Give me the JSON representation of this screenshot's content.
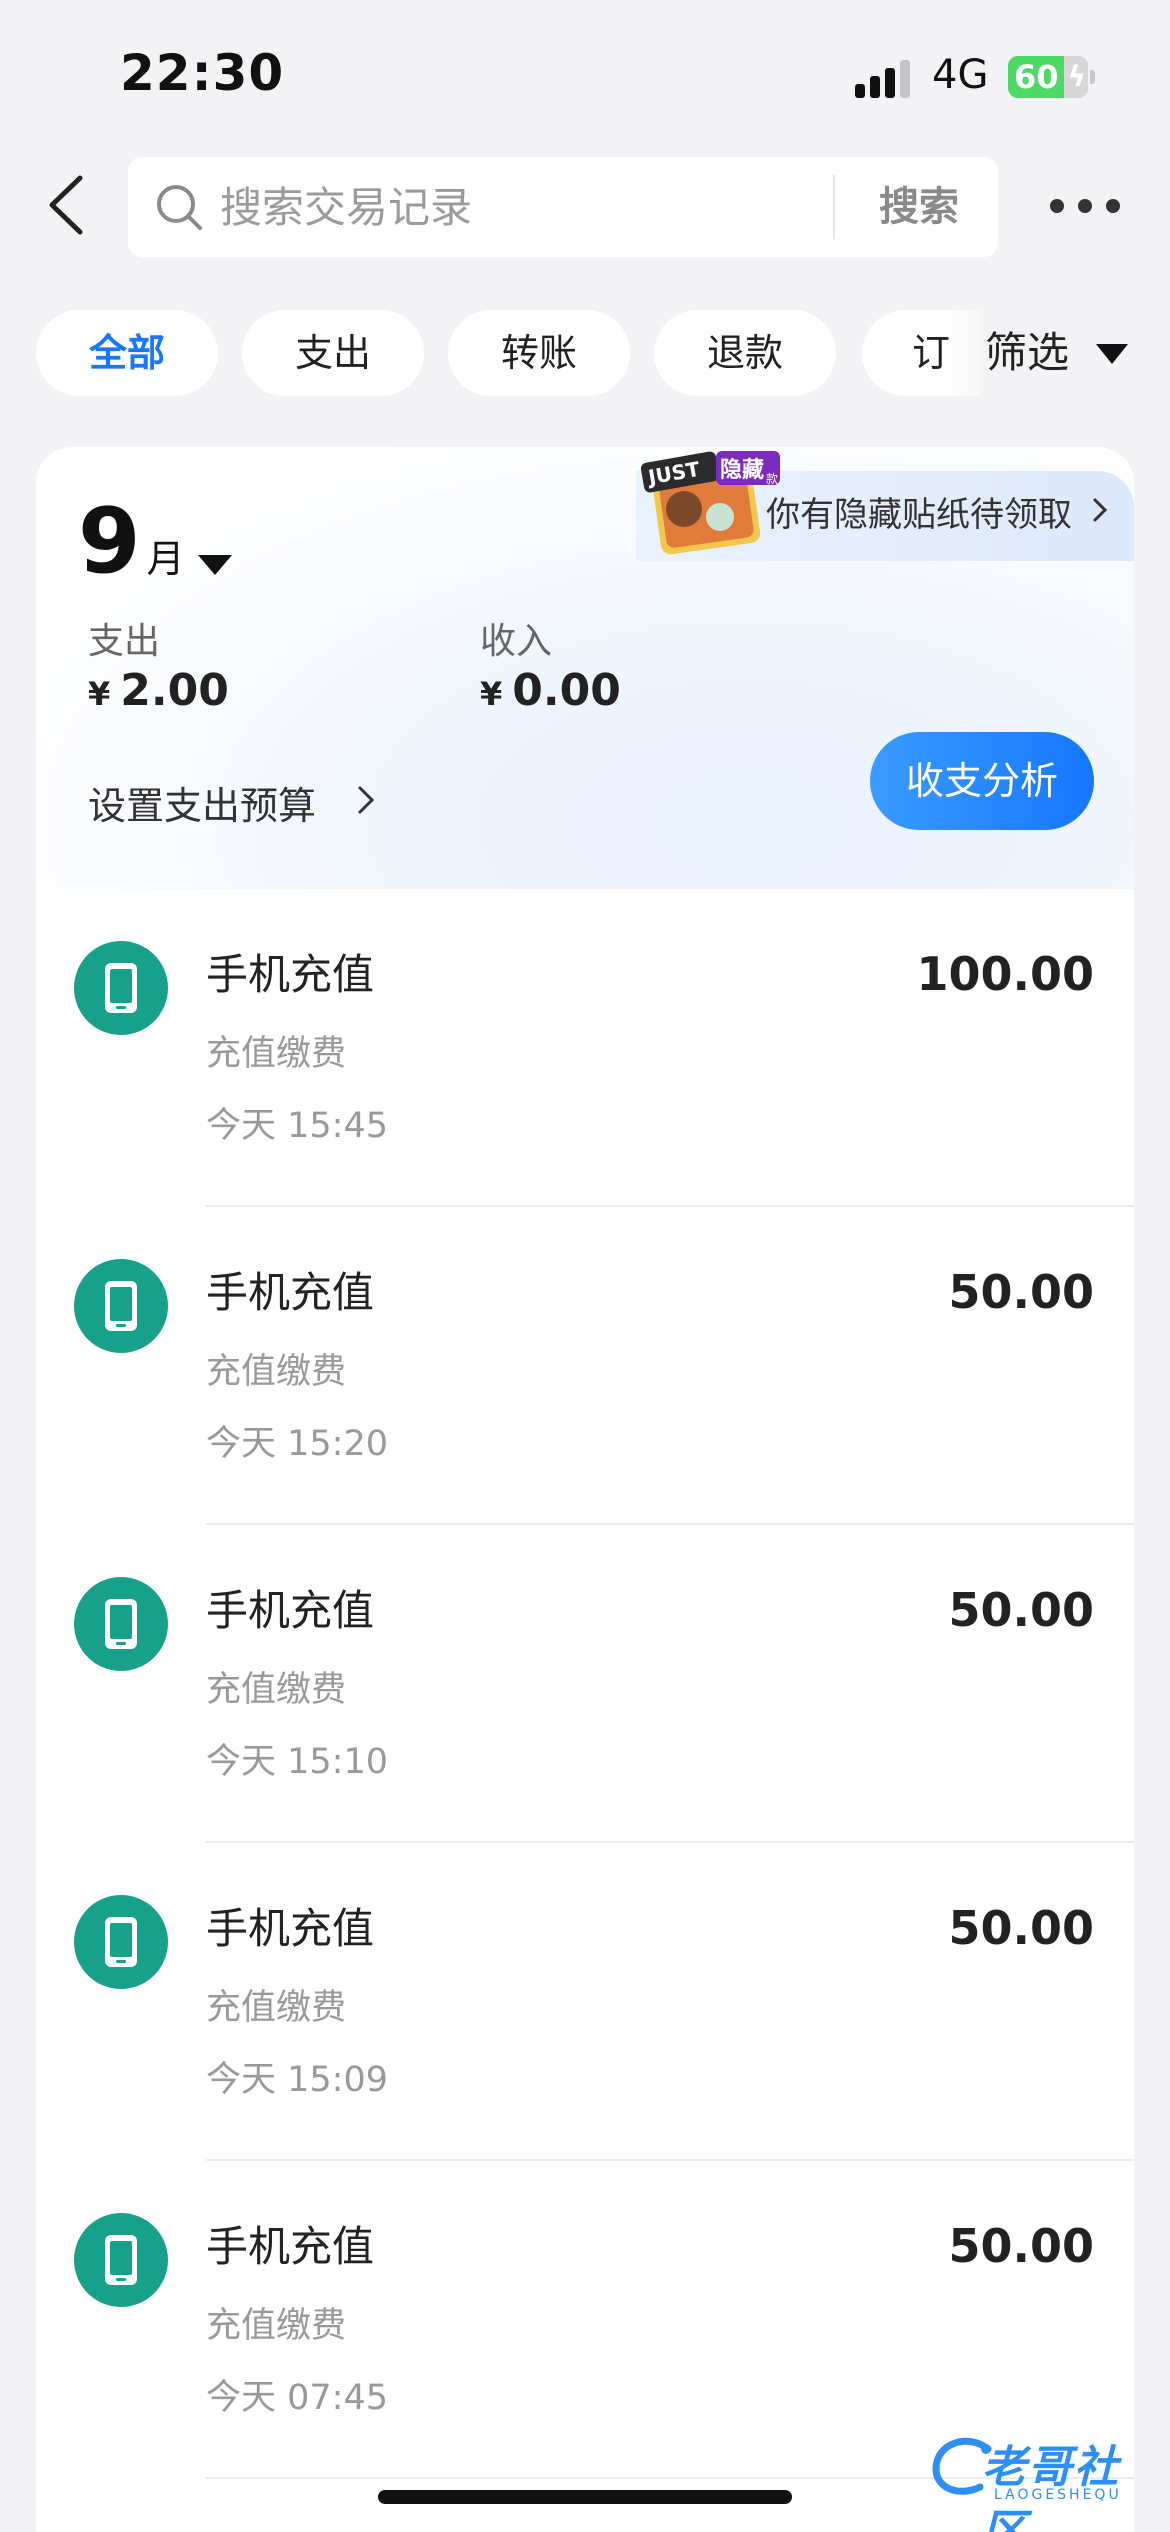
{
  "status_bar": {
    "time": "22:30",
    "network": "4G",
    "battery": "60"
  },
  "header": {
    "search_placeholder": "搜索交易记录",
    "search_button": "搜索"
  },
  "filters": {
    "tabs": [
      {
        "label": "全部",
        "active": true
      },
      {
        "label": "支出",
        "active": false
      },
      {
        "label": "转账",
        "active": false
      },
      {
        "label": "退款",
        "active": false
      },
      {
        "label": "订单",
        "active": false
      }
    ],
    "partial_tab": "订单",
    "filter_label": "筛选"
  },
  "summary": {
    "promo_text": "你有隐藏贴纸待领取",
    "sticker_text": "JUST",
    "sticker_badge": "隐藏",
    "sticker_badge_sub": "款",
    "month_num": "9",
    "month_unit": "月",
    "expense_label": "支出",
    "expense_currency": "¥",
    "expense_value": "2.00",
    "income_label": "收入",
    "income_currency": "¥",
    "income_value": "0.00",
    "budget_link": "设置支出预算",
    "analysis_button": "收支分析"
  },
  "transactions": [
    {
      "title": "手机充值",
      "category": "充值缴费",
      "time": "今天 15:45",
      "amount": "100.00"
    },
    {
      "title": "手机充值",
      "category": "充值缴费",
      "time": "今天 15:20",
      "amount": "50.00"
    },
    {
      "title": "手机充值",
      "category": "充值缴费",
      "time": "今天 15:10",
      "amount": "50.00"
    },
    {
      "title": "手机充值",
      "category": "充值缴费",
      "time": "今天 15:09",
      "amount": "50.00"
    },
    {
      "title": "手机充值",
      "category": "充值缴费",
      "time": "今天 07:45",
      "amount": "50.00"
    }
  ],
  "watermark": {
    "text": "老哥社区",
    "sub": "LAOGESHEQU"
  },
  "colors": {
    "accent": "#1677ff",
    "icon_bg": "#17a08a",
    "page_bg": "#f3f3f5"
  }
}
